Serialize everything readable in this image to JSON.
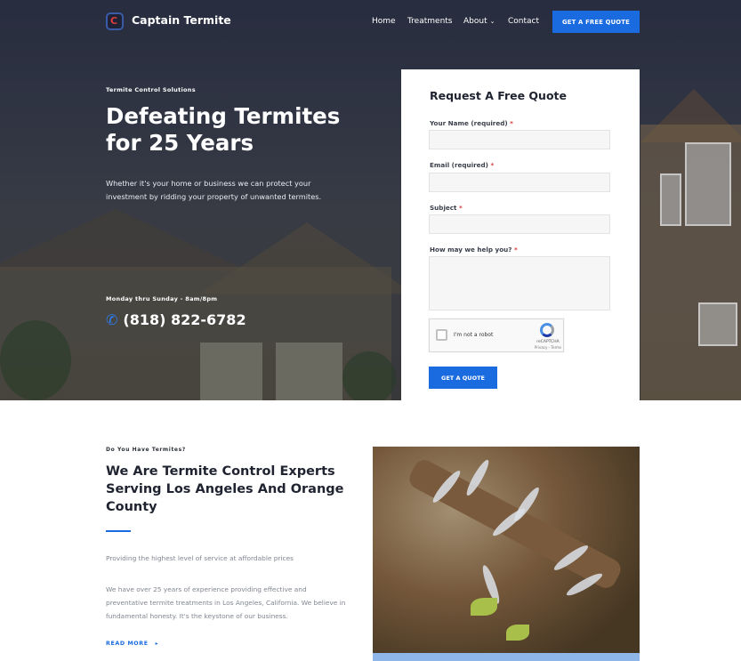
{
  "brand": {
    "name": "Captain Termite",
    "icon": "captain-termite-logo-icon"
  },
  "nav": {
    "home": "Home",
    "treatments": "Treatments",
    "about": "About",
    "contact": "Contact",
    "cta": "GET A FREE QUOTE"
  },
  "hero": {
    "eyebrow": "Termite Control Solutions",
    "title": "Defeating Termites for 25 Years",
    "lede": "Whether it's your home or business we can protect your investment by ridding your property of unwanted termites.",
    "hours": "Monday thru Sunday - 8am/8pm",
    "phone": "(818) 822-6782"
  },
  "form": {
    "title": "Request A Free Quote",
    "name_label": "Your Name (required)",
    "email_label": "Email (required)",
    "subject_label": "Subject",
    "message_label": "How may we help you?",
    "required_mark": "*",
    "captcha_text": "I'm not a robot",
    "captcha_brand": "reCAPTCHA",
    "captcha_terms": "Privacy - Terms",
    "submit": "GET A QUOTE"
  },
  "section": {
    "eyebrow": "Do You Have Termites?",
    "title": "We Are Termite Control Experts Serving Los Angeles And Orange County",
    "p1": "Providing the highest level of service at affordable prices",
    "p2": "We have over 25 years of experience providing effective and preventative termite treatments in Los Angeles, California. We believe in fundamental honesty. It's the keystone of our business.",
    "read_more": "READ MORE"
  },
  "colors": {
    "accent": "#1a6be0",
    "hero_overlay": "#23283a",
    "required": "#d93a3a"
  }
}
